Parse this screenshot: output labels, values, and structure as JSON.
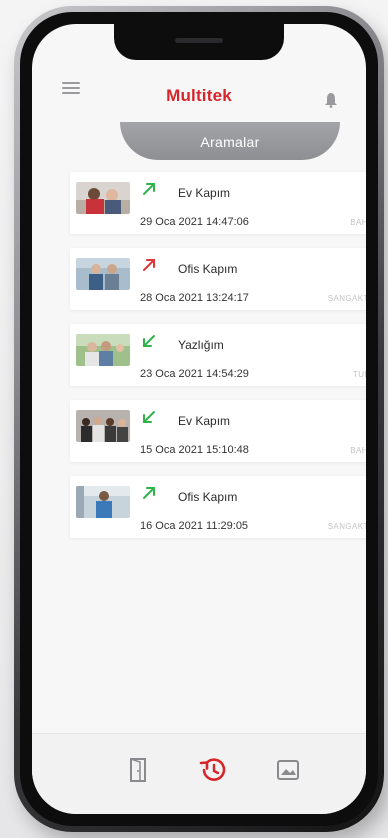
{
  "app": {
    "logo_text": "Multitek"
  },
  "header": {
    "title": "Aramalar"
  },
  "calls": [
    {
      "direction": "outgoing",
      "arrow_color": "#2fb34a",
      "name": "Ev Kapım",
      "datetime": "29 Oca 2021 14:47:06",
      "location": "BAHKOY"
    },
    {
      "direction": "outgoing",
      "arrow_color": "#e0343b",
      "name": "Ofis Kapım",
      "datetime": "28 Oca 2021 13:24:17",
      "location": "SANGAKTEPE"
    },
    {
      "direction": "incoming",
      "arrow_color": "#2fb34a",
      "name": "Yazlığım",
      "datetime": "23 Oca 2021 14:54:29",
      "location": "TURBIM"
    },
    {
      "direction": "incoming",
      "arrow_color": "#2fb34a",
      "name": "Ev Kapım",
      "datetime": "15 Oca 2021 15:10:48",
      "location": "BAHKOY"
    },
    {
      "direction": "outgoing",
      "arrow_color": "#2fb34a",
      "name": "Ofis Kapım",
      "datetime": "16 Oca 2021 11:29:05",
      "location": "SANGAKTEPE"
    }
  ],
  "nav": {
    "items": [
      {
        "icon": "door-icon"
      },
      {
        "icon": "history-icon",
        "color": "#d6252b"
      },
      {
        "icon": "gallery-icon"
      }
    ]
  }
}
